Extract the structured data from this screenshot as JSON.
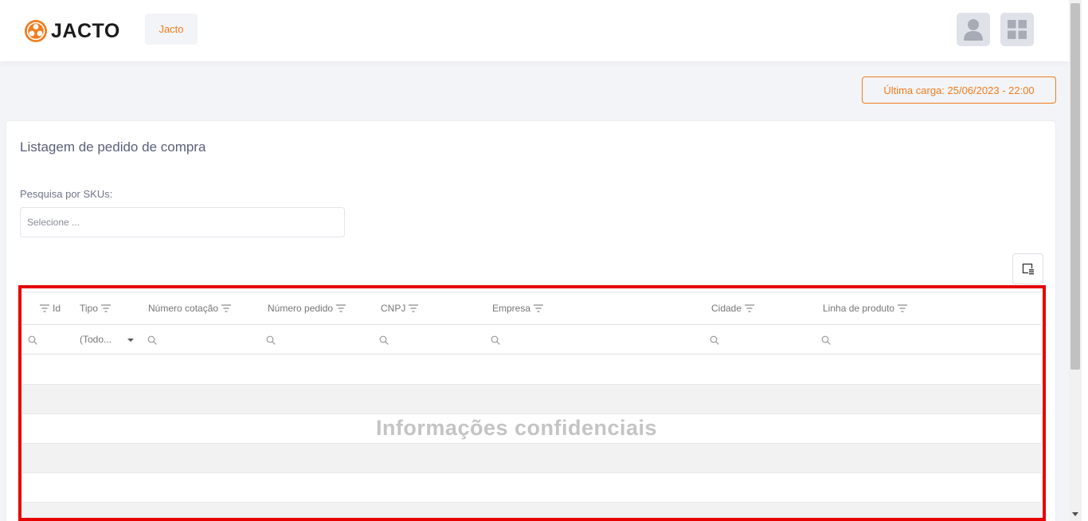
{
  "header": {
    "logo_text": "JACTO",
    "company_chip": "Jacto"
  },
  "status": {
    "last_load": "Última carga: 25/06/2023 - 22:00"
  },
  "card": {
    "title": "Listagem de pedido de compra",
    "sku_label": "Pesquisa por SKUs:",
    "sku_placeholder": "Selecione ..."
  },
  "grid": {
    "columns": [
      "Id",
      "Tipo",
      "Número cotação",
      "Número pedido",
      "CNPJ",
      "Empresa",
      "Cidade",
      "Linha de produto"
    ],
    "type_filter_value": "(Todo...",
    "overlay_text": "Informações confidenciais"
  },
  "colors": {
    "brand_orange": "#f07d1e",
    "highlight_red": "#e60000"
  }
}
